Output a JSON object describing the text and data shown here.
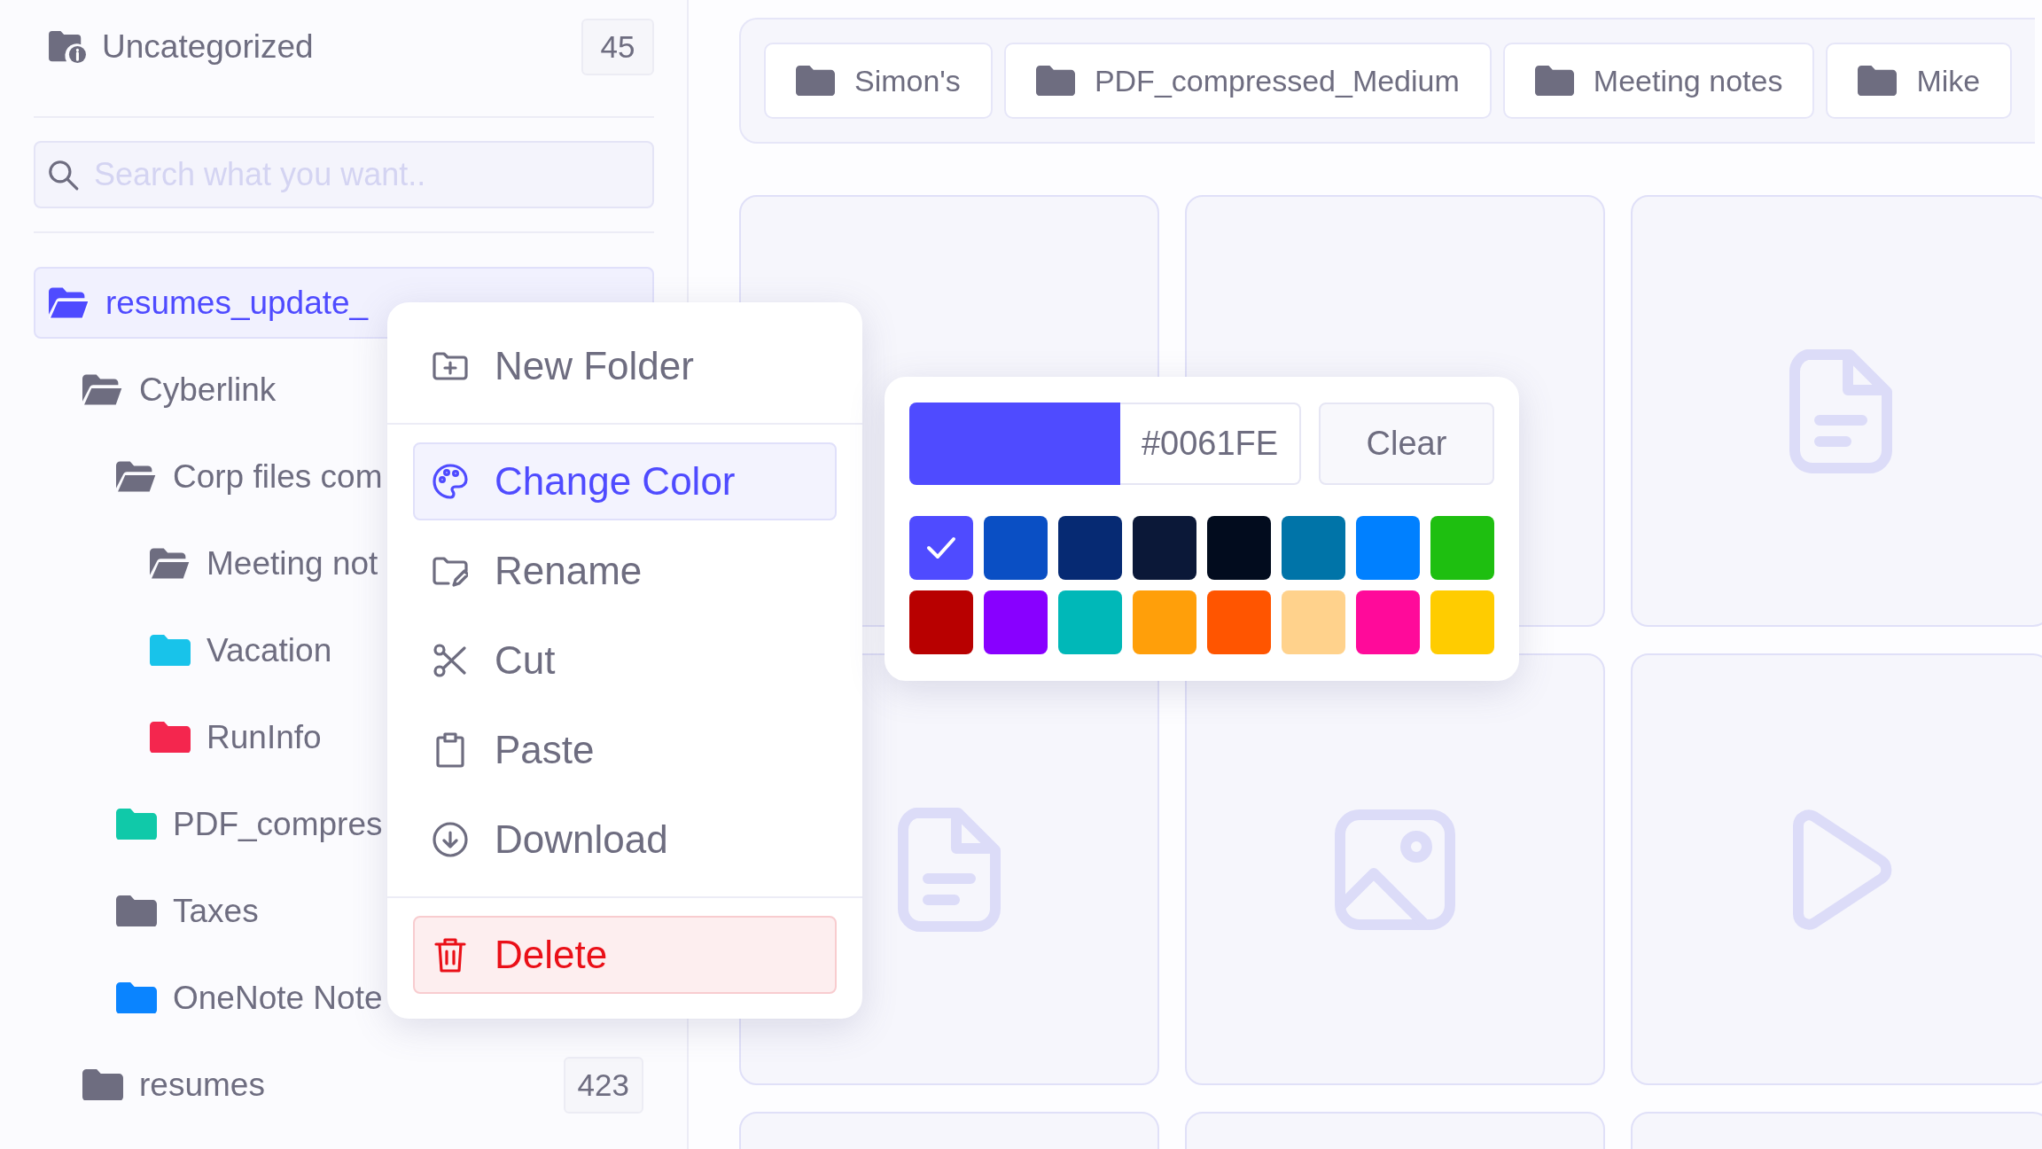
{
  "sidebar": {
    "uncategorized": {
      "label": "Uncategorized",
      "count": "45"
    },
    "search": {
      "placeholder": "Search what you want.."
    },
    "tree": [
      {
        "label": "resumes_update_",
        "open": true,
        "selected": true,
        "color": "#4f4bff",
        "children": [
          {
            "label": "Cyberlink",
            "open": true,
            "selected": false,
            "color": "#6e6d80",
            "children": [
              {
                "label": "Corp files com",
                "open": true,
                "selected": false,
                "color": "#6e6d80",
                "children": [
                  {
                    "label": "Meeting not",
                    "open": true,
                    "selected": false,
                    "color": "#6e6d80"
                  },
                  {
                    "label": "Vacation",
                    "open": false,
                    "selected": false,
                    "color": "#18c3ea"
                  },
                  {
                    "label": "RunInfo",
                    "open": false,
                    "selected": false,
                    "color": "#f4264e"
                  }
                ]
              },
              {
                "label": "PDF_compres",
                "open": false,
                "selected": false,
                "color": "#10c9a9"
              },
              {
                "label": "Taxes",
                "open": false,
                "selected": false,
                "color": "#6e6d80"
              },
              {
                "label": "OneNote Note",
                "open": false,
                "selected": false,
                "color": "#0a84ff"
              }
            ]
          },
          {
            "label": "resumes",
            "open": false,
            "selected": false,
            "color": "#6e6d80",
            "count": "423"
          }
        ]
      }
    ]
  },
  "tabs": [
    {
      "label": "Simon's"
    },
    {
      "label": "PDF_compressed_Medium"
    },
    {
      "label": "Meeting notes"
    },
    {
      "label": "Mike"
    }
  ],
  "cards": [
    {
      "kind": "blank"
    },
    {
      "kind": "blank"
    },
    {
      "kind": "document"
    },
    {
      "kind": "document"
    },
    {
      "kind": "image"
    },
    {
      "kind": "video"
    },
    {
      "kind": "blank"
    },
    {
      "kind": "blank"
    },
    {
      "kind": "blank"
    }
  ],
  "context_menu": {
    "sections": [
      [
        {
          "label": "New Folder",
          "kind": "normal",
          "selected": false
        }
      ],
      [
        {
          "label": "Change Color",
          "kind": "normal",
          "selected": true
        },
        {
          "label": "Rename",
          "kind": "normal",
          "selected": false
        },
        {
          "label": "Cut",
          "kind": "normal",
          "selected": false
        },
        {
          "label": "Paste",
          "kind": "normal",
          "selected": false
        },
        {
          "label": "Download",
          "kind": "normal",
          "selected": false
        }
      ],
      [
        {
          "label": "Delete",
          "kind": "danger",
          "selected": false
        }
      ]
    ]
  },
  "color_picker": {
    "hex": "#0061FE",
    "clear": "Clear",
    "swatches": [
      {
        "color": "#4f4bff",
        "selected": true
      },
      {
        "color": "#0a4fc4",
        "selected": false
      },
      {
        "color": "#062a73",
        "selected": false
      },
      {
        "color": "#0b1838",
        "selected": false
      },
      {
        "color": "#020c1e",
        "selected": false
      },
      {
        "color": "#0074a8",
        "selected": false
      },
      {
        "color": "#0080ff",
        "selected": false
      },
      {
        "color": "#1ebf10",
        "selected": false
      },
      {
        "color": "#b80000",
        "selected": false
      },
      {
        "color": "#8800ff",
        "selected": false
      },
      {
        "color": "#00b8b8",
        "selected": false
      },
      {
        "color": "#ff9f0a",
        "selected": false
      },
      {
        "color": "#ff5500",
        "selected": false
      },
      {
        "color": "#ffd28c",
        "selected": false
      },
      {
        "color": "#ff0a9a",
        "selected": false
      },
      {
        "color": "#ffcc00",
        "selected": false
      }
    ]
  }
}
